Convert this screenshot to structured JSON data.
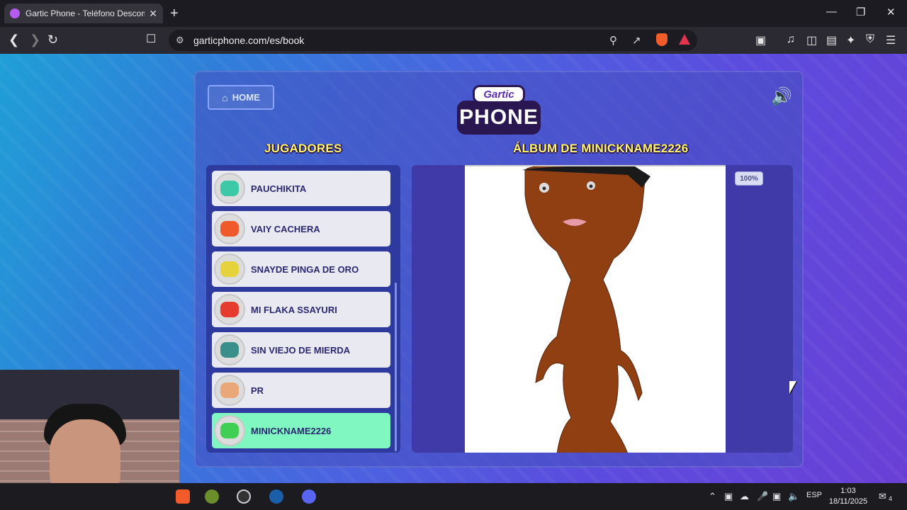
{
  "browser": {
    "tab_title": "Gartic Phone - Teléfono Descom",
    "tab_close": "✕",
    "new_tab": "+",
    "url": "garticphone.com/es/book"
  },
  "window_controls": {
    "minimize": "—",
    "maximize": "❐",
    "close": "✕"
  },
  "header": {
    "home_label": "HOME",
    "logo_top": "Gartic",
    "logo_bottom": "PHONE"
  },
  "sections": {
    "players_title": "JUGADORES",
    "album_title": "ÁLBUM DE MINICKNAME2226"
  },
  "players": [
    {
      "name": "PAUCHIKITA",
      "avatar_color": "#3cc9a8"
    },
    {
      "name": "VAIY CACHERA",
      "avatar_color": "#f05a2a"
    },
    {
      "name": "SNAYDE PINGA DE ORO",
      "avatar_color": "#e6d23a"
    },
    {
      "name": "MI FLAKA SSAYURI",
      "avatar_color": "#e63b2f"
    },
    {
      "name": "SIN VIEJO DE MIERDA",
      "avatar_color": "#3a8f8a"
    },
    {
      "name": "PR",
      "avatar_color": "#e9a77a"
    },
    {
      "name": "MINICKNAME2226",
      "avatar_color": "#3fcf55",
      "active": true
    }
  ],
  "album": {
    "zoom": "100%"
  },
  "taskbar": {
    "language": "ESP",
    "time": "1:03",
    "date": "18/11/2025",
    "notifications": "4"
  }
}
